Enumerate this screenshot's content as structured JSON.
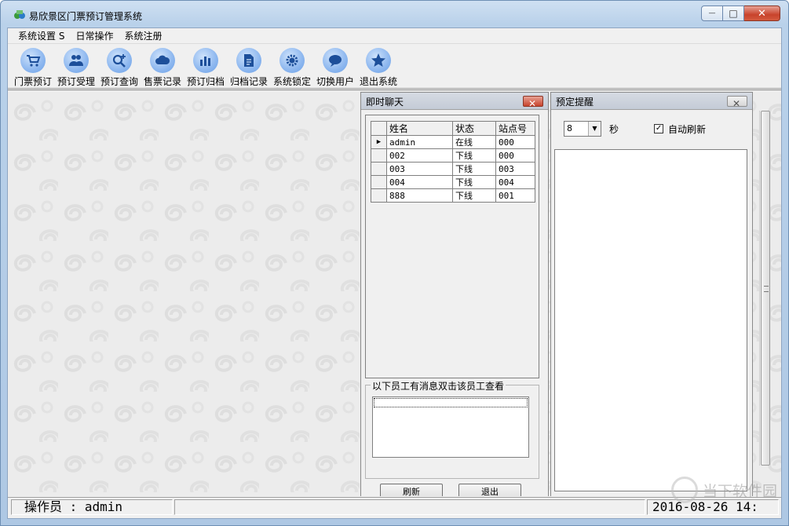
{
  "window": {
    "title": "易欣景区门票预订管理系统",
    "close_glyph": "✕",
    "minimize_glyph": "—",
    "maximize_glyph": "□"
  },
  "menu": [
    "系统设置 S",
    "日常操作",
    "系统注册"
  ],
  "toolbar": [
    {
      "label": "门票预订",
      "icon": "cart-icon"
    },
    {
      "label": "预订受理",
      "icon": "users-icon"
    },
    {
      "label": "预订查询",
      "icon": "search-icon"
    },
    {
      "label": "售票记录",
      "icon": "cloud-icon"
    },
    {
      "label": "预订归档",
      "icon": "bar-chart-icon"
    },
    {
      "label": "归档记录",
      "icon": "document-icon"
    },
    {
      "label": "系统锁定",
      "icon": "gear-icon"
    },
    {
      "label": "切换用户",
      "icon": "chat-bubble-icon"
    },
    {
      "label": "退出系统",
      "icon": "star-icon"
    }
  ],
  "chat": {
    "title": "即时聊天",
    "columns": [
      "姓名",
      "状态",
      "站点号"
    ],
    "rows": [
      {
        "name": "admin",
        "status": "在线",
        "site": "000",
        "current": true
      },
      {
        "name": "002",
        "status": "下线",
        "site": "000",
        "current": false
      },
      {
        "name": "003",
        "status": "下线",
        "site": "003",
        "current": false
      },
      {
        "name": "004",
        "status": "下线",
        "site": "004",
        "current": false
      },
      {
        "name": "888",
        "status": "下线",
        "site": "001",
        "current": false
      }
    ],
    "message_group_label": "以下员工有消息双击该员工查看",
    "refresh_button": "刷新",
    "exit_button": "退出"
  },
  "reminder": {
    "title": "预定提醒",
    "interval_value": "8",
    "interval_unit": "秒",
    "auto_refresh_label": "自动刷新",
    "auto_refresh_checked": true
  },
  "status": {
    "operator": "操作员 : admin",
    "datetime": "2016-08-26 14:"
  },
  "watermark": "当下软件园"
}
